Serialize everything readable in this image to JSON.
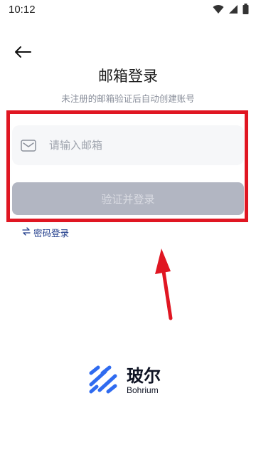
{
  "status_bar": {
    "time": "10:12",
    "icons": [
      "wifi-icon",
      "signal-icon",
      "battery-icon"
    ]
  },
  "header": {
    "back_icon": "back-arrow-icon",
    "title": "邮箱登录",
    "subtitle": "未注册的邮箱验证后自动创建账号"
  },
  "form": {
    "email_placeholder": "请输入邮箱",
    "email_value": "",
    "submit_label": "验证并登录",
    "submit_enabled": false
  },
  "alt_login": {
    "icon": "swap-icon",
    "label": "密码登录"
  },
  "brand": {
    "name": "玻尔",
    "english_name": "Bohrium"
  },
  "colors": {
    "highlight_border": "#e01622",
    "annotation_arrow": "#e01622",
    "button_disabled": "#b2b6c2",
    "link": "#1d3a8a",
    "logo_blue": "#2f6bf0"
  }
}
